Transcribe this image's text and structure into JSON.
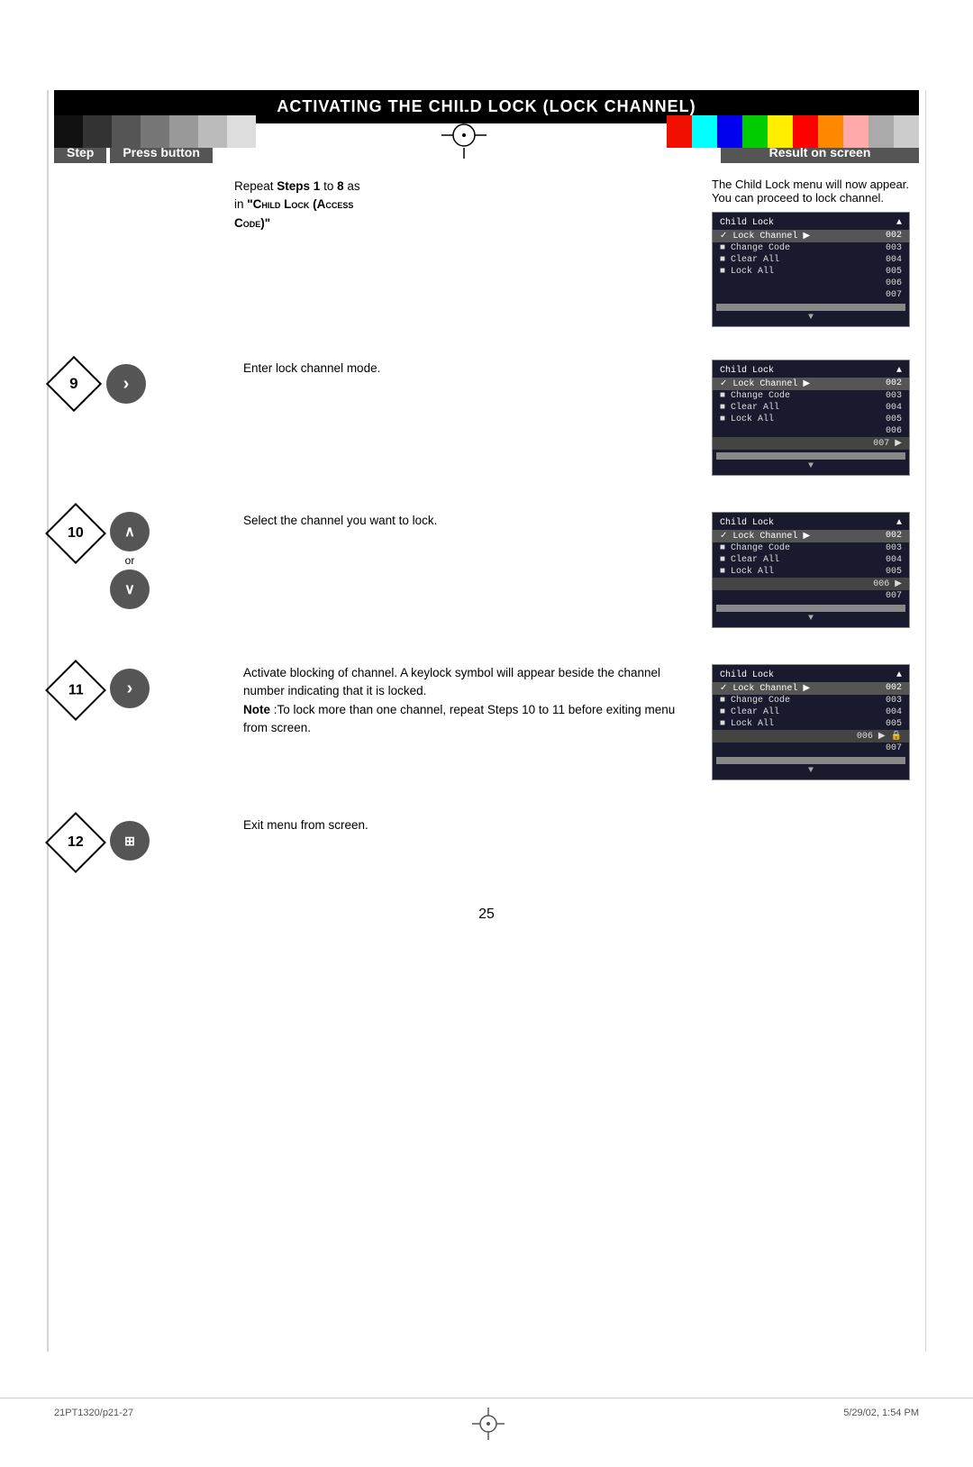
{
  "topBar": {
    "leftSwatches": [
      "#000",
      "#222",
      "#444",
      "#666",
      "#888",
      "#aaa",
      "#ccc"
    ],
    "rightSwatches": [
      "#f0f",
      "#0ff",
      "#00f",
      "#0f0",
      "#ff0",
      "#f00",
      "#f80",
      "#faa",
      "#aaa",
      "#ccc"
    ]
  },
  "title": "Activating the Child Lock (Lock Channel)",
  "header": {
    "step": "Step",
    "press": "Press button",
    "result": "Result on screen"
  },
  "intro": {
    "description1": "Repeat ",
    "description2": "Steps 1",
    "description3": " to ",
    "description4": "8",
    "description5": " as in ",
    "description6": "\"Child Lock (Access Code)\"",
    "description_full": "Repeat Steps 1 to 8 as in \"Child Lock (Access Code)\"",
    "side_text": "The Child Lock menu will now appear. You can proceed to lock channel."
  },
  "steps": [
    {
      "number": "9",
      "button": ">",
      "description": "Enter lock channel mode.",
      "menu": {
        "title": "Child Lock",
        "items": [
          {
            "label": "✓ Lock Channel ▶",
            "value": "002",
            "selected": false
          },
          {
            "label": "■ Change Code",
            "value": "003",
            "selected": false
          },
          {
            "label": "■ Clear All",
            "value": "004",
            "selected": false
          },
          {
            "label": "■ Lock All",
            "value": "005",
            "selected": false
          },
          {
            "label": "",
            "value": "006",
            "selected": false
          },
          {
            "label": "",
            "value": "007 ▶",
            "selected": true
          }
        ]
      }
    },
    {
      "number": "10",
      "button_up": "∧",
      "button_down": "∨",
      "or": "or",
      "description": "Select the channel you want to lock.",
      "menu": {
        "title": "Child Lock",
        "items": [
          {
            "label": "✓ Lock Channel ▶",
            "value": "002",
            "selected": false
          },
          {
            "label": "■ Change Code",
            "value": "003",
            "selected": false
          },
          {
            "label": "■ Clear All",
            "value": "004",
            "selected": false
          },
          {
            "label": "■ Lock All",
            "value": "005",
            "selected": false
          },
          {
            "label": "",
            "value": "006 ▶",
            "selected": true
          },
          {
            "label": "",
            "value": "007",
            "selected": false
          }
        ]
      }
    },
    {
      "number": "11",
      "button": ">",
      "description": "Activate blocking of channel. A keylock symbol will appear beside the channel number indicating that it is locked.",
      "note": "Note : To lock more than one channel, repeat Steps 10 to 11 before exiting menu from screen.",
      "menu": {
        "title": "Child Lock",
        "items": [
          {
            "label": "✓ Lock Channel ▶",
            "value": "002",
            "selected": false
          },
          {
            "label": "■ Change Code",
            "value": "003",
            "selected": false
          },
          {
            "label": "■ Clear All",
            "value": "004",
            "selected": false
          },
          {
            "label": "■ Lock All",
            "value": "005",
            "selected": false
          },
          {
            "label": "",
            "value": "006 ▶ 🔒",
            "selected": true
          },
          {
            "label": "",
            "value": "007",
            "selected": false
          }
        ]
      }
    },
    {
      "number": "12",
      "button": "⊞",
      "description": "Exit menu from screen.",
      "menu": null
    }
  ],
  "pageNumber": "25",
  "footer": {
    "left": "21PT1320/p21-27",
    "center": "25",
    "right": "5/29/02, 1:54 PM"
  }
}
